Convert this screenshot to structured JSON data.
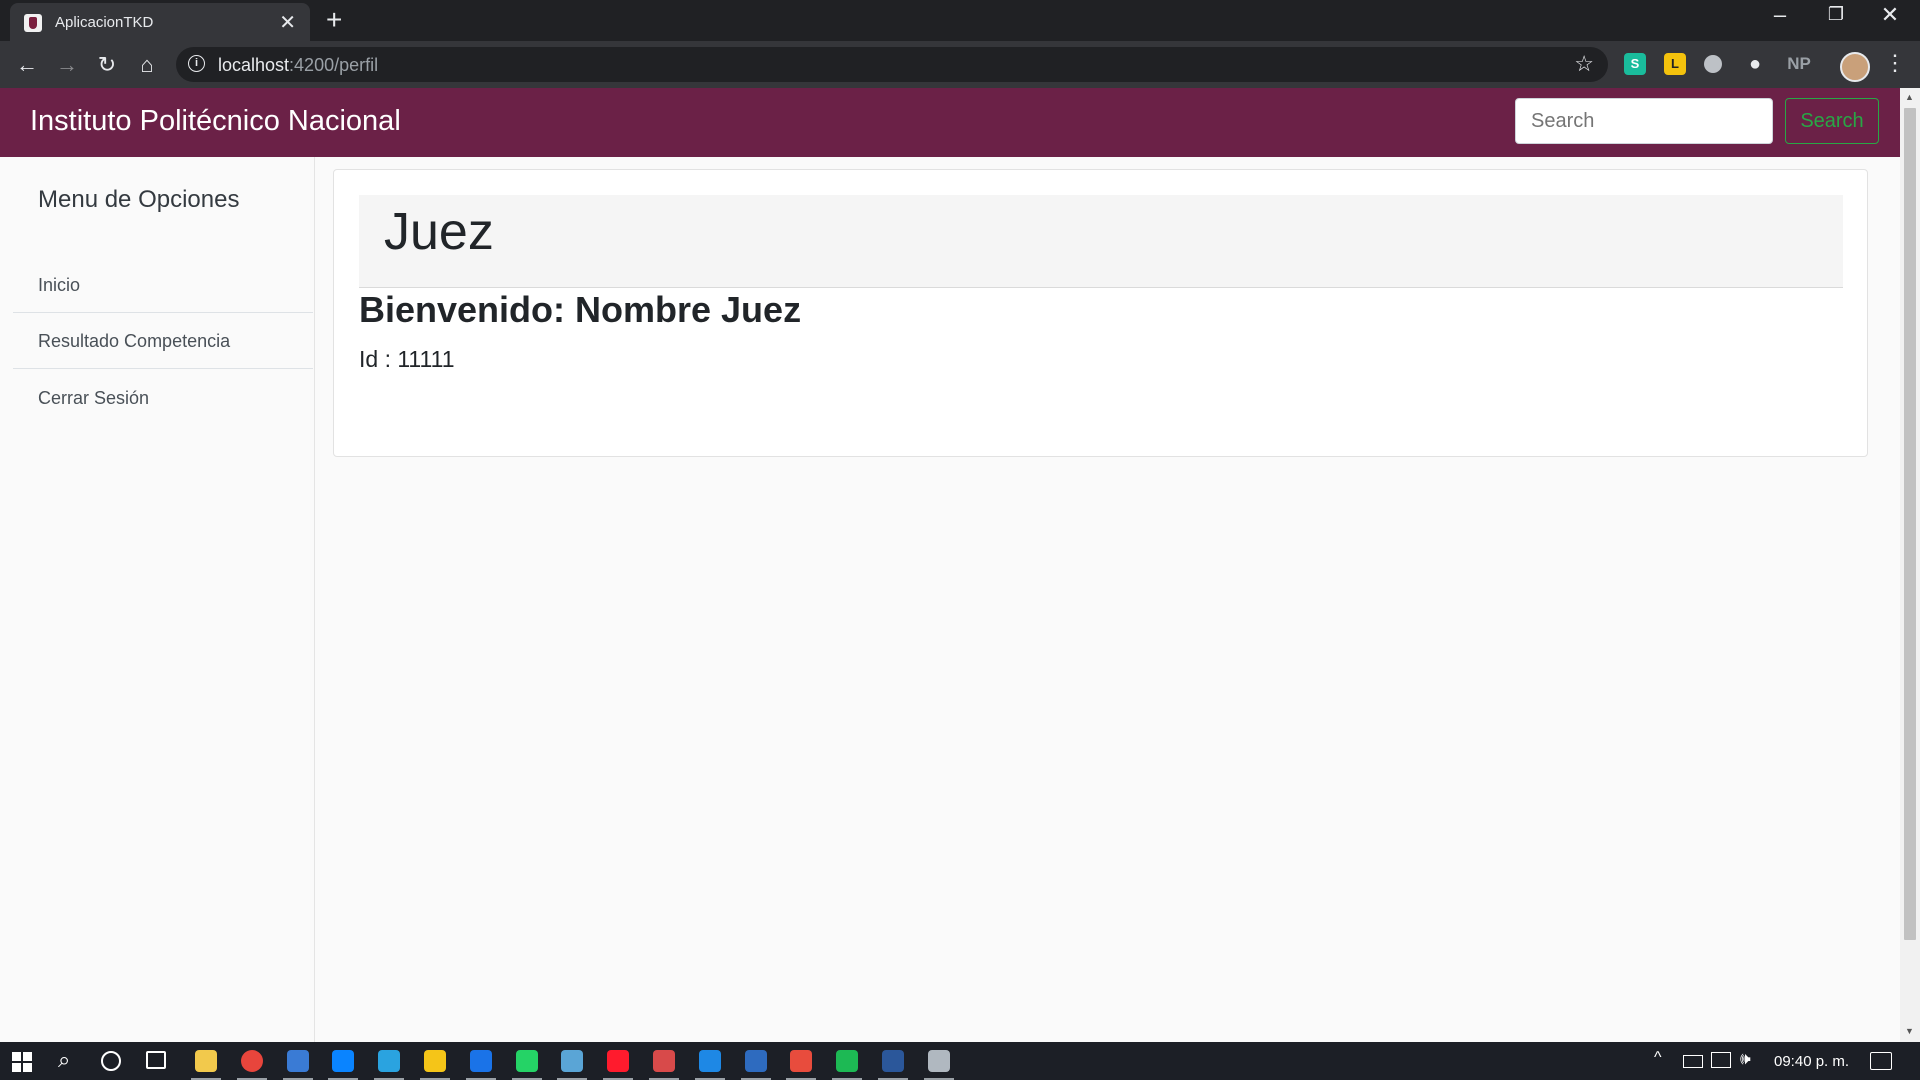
{
  "browser": {
    "tab_title": "AplicacionTKD",
    "url_host": "localhost",
    "url_path": ":4200/perfil",
    "extensions": {
      "np_label": "NP"
    }
  },
  "navbar": {
    "brand": "Instituto Politécnico Nacional",
    "search_placeholder": "Search",
    "search_button": "Search",
    "color": "#6b2147",
    "button_color": "#28a745"
  },
  "sidebar": {
    "title": "Menu de Opciones",
    "items": [
      {
        "label": "Inicio"
      },
      {
        "label": "Resultado Competencia"
      },
      {
        "label": "Cerrar Sesión"
      }
    ]
  },
  "profile": {
    "role": "Juez",
    "welcome": "Bienvenido: Nombre Juez",
    "id_line": "Id : 11111"
  },
  "taskbar": {
    "clock": "09:40 p. m.",
    "apps": [
      {
        "name": "file-explorer-icon",
        "color": "#f2c94c"
      },
      {
        "name": "chrome-icon",
        "color": "#e8453c"
      },
      {
        "name": "store-icon",
        "color": "#3a7bd5"
      },
      {
        "name": "edge-icon",
        "color": "#0a84ff"
      },
      {
        "name": "telegram-icon",
        "color": "#2aa3e0"
      },
      {
        "name": "norton-icon",
        "color": "#f5c518"
      },
      {
        "name": "maps-icon",
        "color": "#1a73e8"
      },
      {
        "name": "whatsapp-icon",
        "color": "#25d366"
      },
      {
        "name": "zoom-icon",
        "color": "#5aa5d6"
      },
      {
        "name": "opera-icon",
        "color": "#ff1b2d"
      },
      {
        "name": "game-icon",
        "color": "#d84a4a"
      },
      {
        "name": "vscode-icon",
        "color": "#1e88e5"
      },
      {
        "name": "project-icon",
        "color": "#2e6bbf"
      },
      {
        "name": "chrome-canary-icon",
        "color": "#e84c3d"
      },
      {
        "name": "spotify-icon",
        "color": "#1db954"
      },
      {
        "name": "word-icon",
        "color": "#2b579a"
      },
      {
        "name": "app-icon",
        "color": "#b0b8c0"
      }
    ]
  }
}
